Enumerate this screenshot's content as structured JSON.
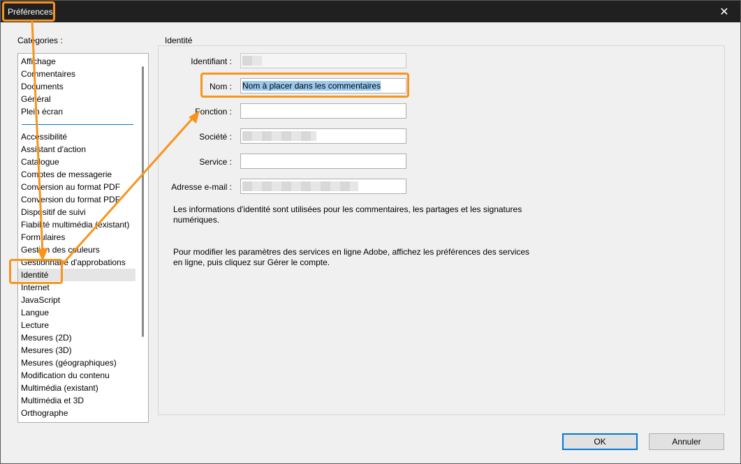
{
  "window": {
    "title": "Préférences",
    "close_glyph": "✕"
  },
  "categories": {
    "label": "Catégories :",
    "group1": [
      "Affichage",
      "Commentaires",
      "Documents",
      "Général",
      "Plein écran"
    ],
    "group2": [
      "Accessibilité",
      "Assistant d'action",
      "Catalogue",
      "Comptes de messagerie",
      "Conversion au format PDF",
      "Conversion du format PDF",
      "Dispositif de suivi",
      "Fiabilité multimédia (existant)",
      "Formulaires",
      "Gestion des couleurs",
      "Gestionnaire d'approbations",
      "Identité",
      "Internet",
      "JavaScript",
      "Langue",
      "Lecture",
      "Mesures (2D)",
      "Mesures (3D)",
      "Mesures (géographiques)",
      "Modification du contenu",
      "Multimédia (existant)",
      "Multimédia et 3D",
      "Orthographe"
    ],
    "selected": "Identité"
  },
  "identity": {
    "group_title": "Identité",
    "fields": {
      "identifiant": {
        "label": "Identifiant :",
        "value": ""
      },
      "nom": {
        "label": "Nom :",
        "value": "Nom à placer dans les commentaires"
      },
      "fonction": {
        "label": "Fonction :",
        "value": ""
      },
      "societe": {
        "label": "Société :",
        "value": ""
      },
      "service": {
        "label": "Service :",
        "value": ""
      },
      "email": {
        "label": "Adresse e-mail :",
        "value": ""
      }
    },
    "info1": "Les informations d'identité sont utilisées pour les commentaires, les partages et les signatures numériques.",
    "info2": "Pour modifier les paramètres des services en ligne Adobe, affichez les préférences des services en ligne, puis cliquez sur Gérer le compte."
  },
  "buttons": {
    "ok": "OK",
    "cancel": "Annuler"
  },
  "colors": {
    "highlight": "#f7941d",
    "selection": "#99c9ef",
    "accent": "#0078d4"
  }
}
